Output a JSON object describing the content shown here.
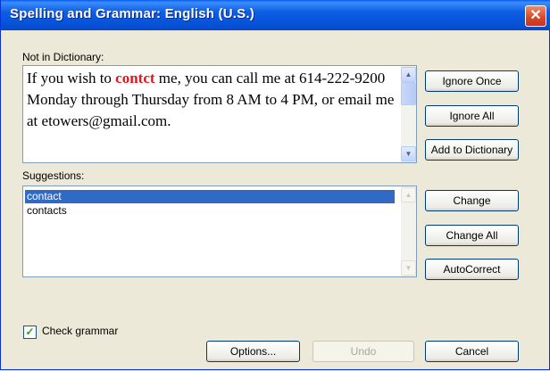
{
  "window": {
    "title": "Spelling and Grammar: English (U.S.)",
    "close_glyph": "✕"
  },
  "not_in_dictionary": {
    "label": "Not in Dictionary:",
    "text_before": "If you wish to ",
    "error_word": "contct",
    "text_after": " me, you can call me at 614-222-9200 Monday through Thursday from 8 AM to 4 PM, or email me at etowers@gmail.com."
  },
  "suggestions": {
    "label": "Suggestions:",
    "items": [
      "contact",
      "contacts"
    ],
    "selected_index": 0
  },
  "buttons": {
    "ignore_once": "Ignore Once",
    "ignore_all": "Ignore All",
    "add_to_dictionary": "Add to Dictionary",
    "change": "Change",
    "change_all": "Change All",
    "autocorrect": "AutoCorrect",
    "options": "Options...",
    "undo": "Undo",
    "cancel": "Cancel"
  },
  "check_grammar": {
    "label": "Check grammar",
    "checked": true
  },
  "icons": {
    "scroll_up": "▲",
    "scroll_down": "▼",
    "check_mark": "✓"
  }
}
